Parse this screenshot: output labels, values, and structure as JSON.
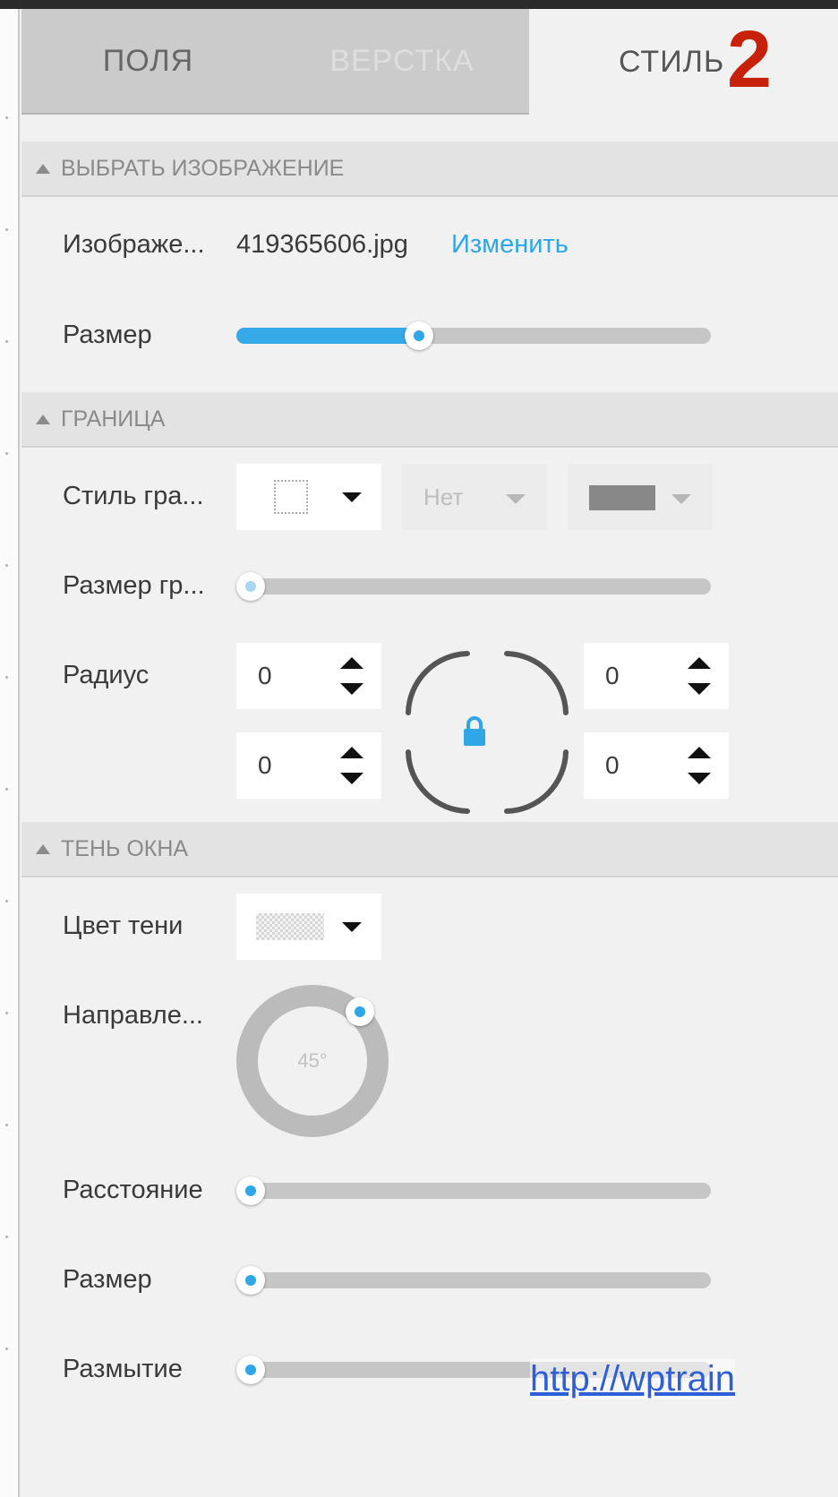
{
  "tabs": {
    "fields": "ПОЛЯ",
    "layout": "ВЕРСТКА",
    "style": "СТИЛЬ",
    "active": "style"
  },
  "annotation": "2",
  "image_section": {
    "header": "ВЫБРАТЬ ИЗОБРАЖЕНИЕ",
    "image_label": "Изображе...",
    "filename": "419365606.jpg",
    "change_link": "Изменить",
    "size_label": "Размер",
    "size_value": 0.385
  },
  "border_section": {
    "header": "ГРАНИЦА",
    "style_label": "Стиль гра...",
    "style_option": "Нет",
    "size_label": "Размер гр...",
    "size_value": 0,
    "radius_label": "Радиус",
    "radius": {
      "top_left": "0",
      "top_right": "0",
      "bottom_left": "0",
      "bottom_right": "0"
    },
    "color": "#888888"
  },
  "shadow_section": {
    "header": "ТЕНЬ ОКНА",
    "color_label": "Цвет тени",
    "direction_label": "Направле...",
    "direction_value": "45°",
    "distance_label": "Расстояние",
    "distance_value": 0,
    "size_label": "Размер",
    "size_value": 0,
    "blur_label": "Размытие",
    "blur_value": 0
  },
  "watermark": "http://wptrain",
  "colors": {
    "accent": "#2fa6e6",
    "annotation": "#c8210a",
    "link": "#2fa6e6"
  }
}
